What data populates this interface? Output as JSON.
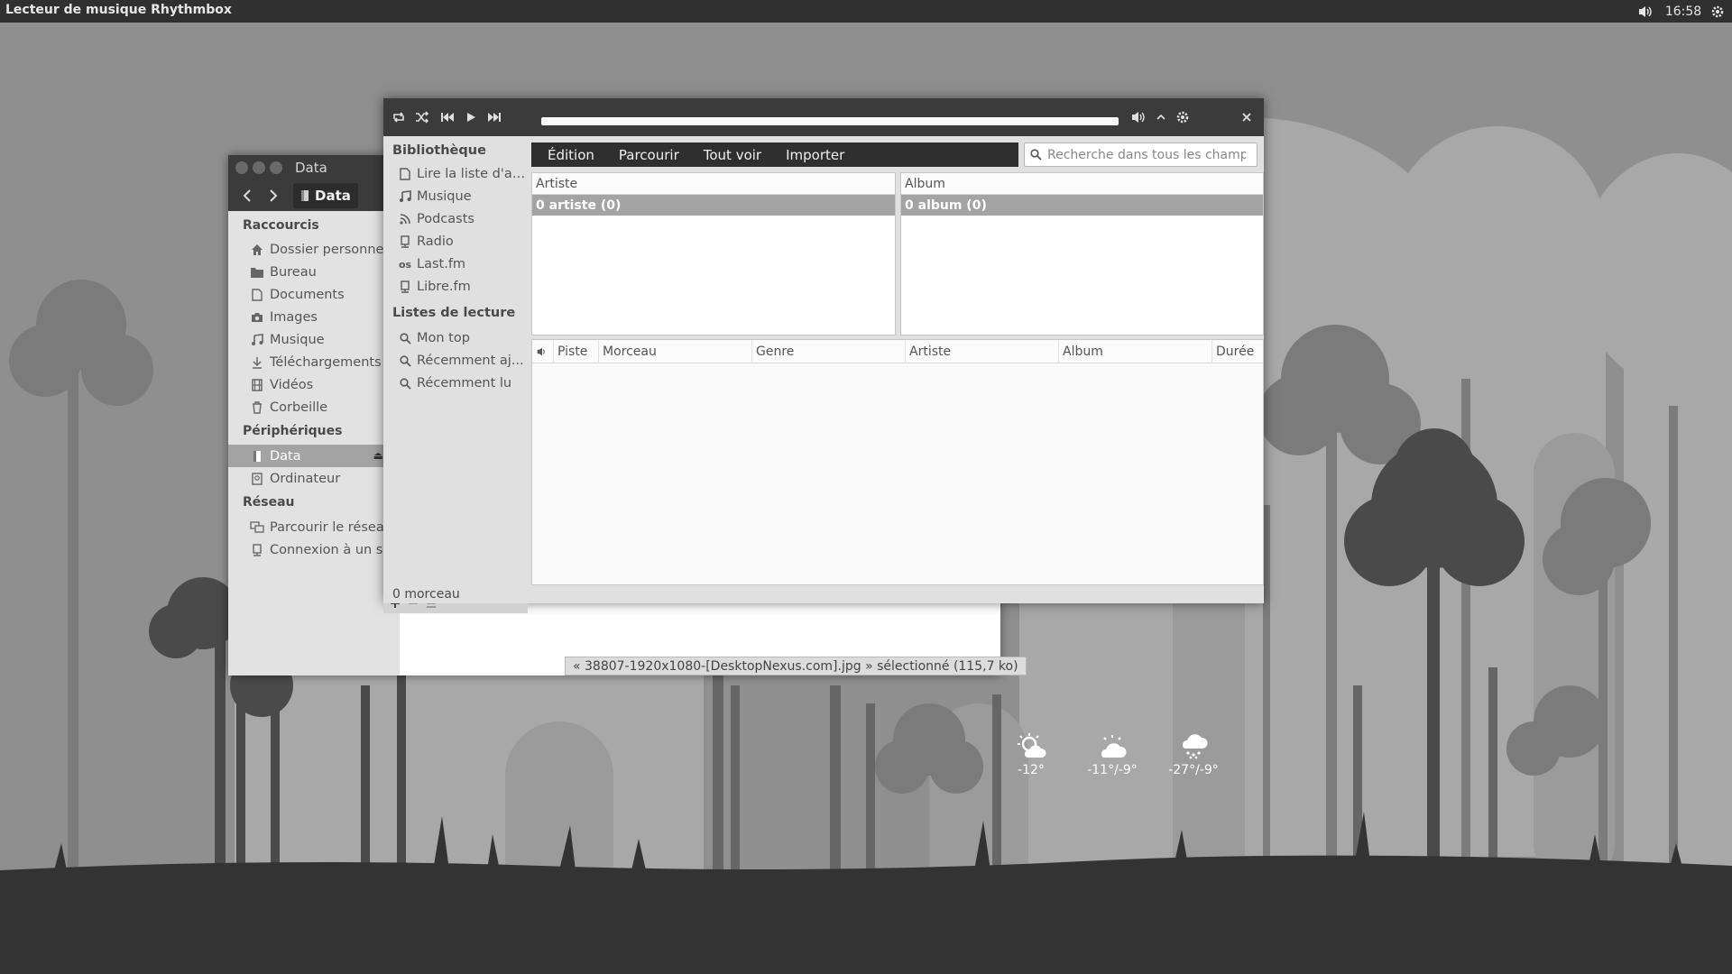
{
  "top_panel": {
    "app_title": "Lecteur de musique Rhythmbox",
    "clock": "16:58",
    "icons": [
      "volume-icon",
      "gear-icon"
    ]
  },
  "files": {
    "window_title": "Data",
    "path_button": "Data",
    "sections": {
      "shortcuts": "Raccourcis",
      "devices": "Périphériques",
      "network": "Réseau"
    },
    "shortcuts": [
      {
        "label": "Dossier personnel",
        "icon": "home-icon"
      },
      {
        "label": "Bureau",
        "icon": "folder-icon"
      },
      {
        "label": "Documents",
        "icon": "document-icon"
      },
      {
        "label": "Images",
        "icon": "camera-icon"
      },
      {
        "label": "Musique",
        "icon": "music-icon"
      },
      {
        "label": "Téléchargements",
        "icon": "download-icon"
      },
      {
        "label": "Vidéos",
        "icon": "film-icon"
      },
      {
        "label": "Corbeille",
        "icon": "trash-icon"
      }
    ],
    "devices": [
      {
        "label": "Data",
        "icon": "drive-icon",
        "selected": true
      },
      {
        "label": "Ordinateur",
        "icon": "computer-icon"
      }
    ],
    "network": [
      {
        "label": "Parcourir le réseau",
        "icon": "network-icon"
      },
      {
        "label": "Connexion à un ser...",
        "icon": "server-icon"
      }
    ],
    "status": "« 38807-1920x1080-[DesktopNexus.com].jpg » sélectionné (115,7 ko)"
  },
  "rhythmbox": {
    "playback_controls": [
      "repeat-icon",
      "shuffle-icon",
      "previous-icon",
      "play-icon",
      "next-icon"
    ],
    "progress": 0.0,
    "sidebar": {
      "library_title": "Bibliothèque",
      "library": [
        {
          "label": "Lire la liste d'at...",
          "icon": "document-icon"
        },
        {
          "label": "Musique",
          "icon": "music-icon"
        },
        {
          "label": "Podcasts",
          "icon": "rss-icon"
        },
        {
          "label": "Radio",
          "icon": "radio-icon"
        },
        {
          "label": "Last.fm",
          "icon": "lastfm-icon"
        },
        {
          "label": "Libre.fm",
          "icon": "radio-icon"
        }
      ],
      "playlists_title": "Listes de lecture",
      "playlists": [
        {
          "label": "Mon top",
          "icon": "search-icon"
        },
        {
          "label": "Récemment aj...",
          "icon": "search-icon"
        },
        {
          "label": "Récemment lu",
          "icon": "search-icon"
        }
      ]
    },
    "menus": [
      "Édition",
      "Parcourir",
      "Tout voir",
      "Importer"
    ],
    "search_placeholder": "Recherche dans tous les champs",
    "artist_browser": {
      "header": "Artiste",
      "row": "0 artiste (0)"
    },
    "album_browser": {
      "header": "Album",
      "row": "0 album (0)"
    },
    "track_columns": [
      "Piste",
      "Morceau",
      "Genre",
      "Artiste",
      "Album",
      "Durée"
    ],
    "status": "0 morceau"
  },
  "weather": [
    {
      "temp": "-12°",
      "icon": "partly-sunny-icon"
    },
    {
      "temp": "-11°/-9°",
      "icon": "partly-cloudy-icon"
    },
    {
      "temp": "-27°/-9°",
      "icon": "snow-icon"
    }
  ]
}
